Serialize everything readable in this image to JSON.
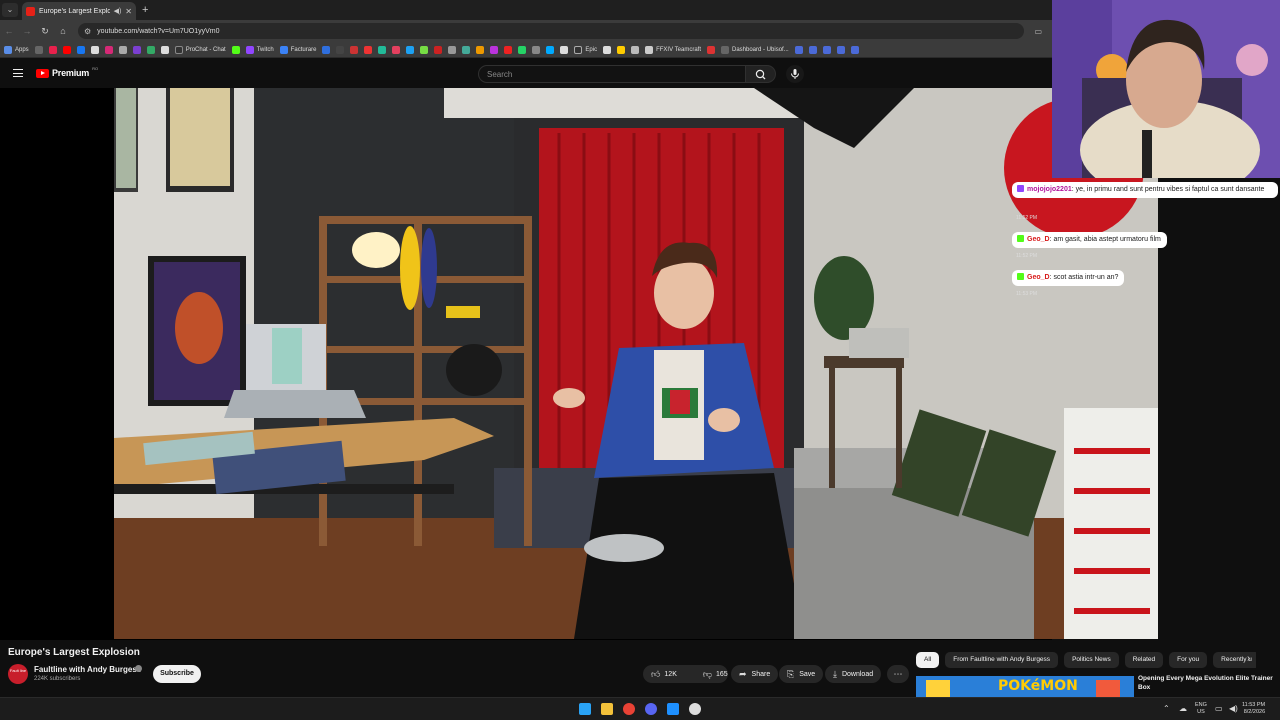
{
  "browser": {
    "tab_title": "Europe's Largest Explosion",
    "url": "youtube.com/watch?v=Um7UO1yyVm0",
    "bookmarks": [
      "Apps",
      "ProChat - Chat",
      "Twitch",
      "Facturare",
      "Epic",
      "FFXIV Teamcraft",
      "Dashboard - Ubisof..."
    ]
  },
  "youtube": {
    "logo_text": "Premium",
    "logo_region": "RO",
    "search_placeholder": "Search",
    "video": {
      "title": "Europe's Largest Explosion",
      "likes": "12K",
      "dislikes": "165",
      "share_label": "Share",
      "save_label": "Save",
      "download_label": "Download"
    },
    "channel": {
      "name": "Faultline with Andy Burgess",
      "subscribers": "224K subscribers",
      "avatar_text": "Fault line",
      "subscribe_label": "Subscribe"
    },
    "chips": [
      "All",
      "From Faultline with Andy Burgess",
      "Politics News",
      "Related",
      "For you",
      "Recently u"
    ],
    "recommended": {
      "title": "Opening Every Mega Evolution Elite Trainer Box",
      "thumb_text": "POKéMON"
    }
  },
  "stream_chat": {
    "messages": [
      {
        "user": "mojojojo2201",
        "text": ": ye, in primu rand sunt pentru vibes si faptul ca sunt dansante",
        "time": "11:52 PM",
        "color": "#b0149b"
      },
      {
        "user": "Geo_D",
        "text": ": am gasit, abia astept urmatoru film",
        "time": "11:52 PM",
        "color": "#d81919"
      },
      {
        "user": "Geo_D",
        "text": ": scot astia intr-un an?",
        "time": "11:53 PM",
        "color": "#d81919"
      }
    ]
  },
  "taskbar": {
    "lang_top": "ENG",
    "lang_bottom": "US",
    "time": "11:53 PM",
    "date": "8/2/2026"
  },
  "colors": {
    "youtube_red": "#ff0000",
    "background": "#0f0f0f",
    "pill": "#272727"
  }
}
